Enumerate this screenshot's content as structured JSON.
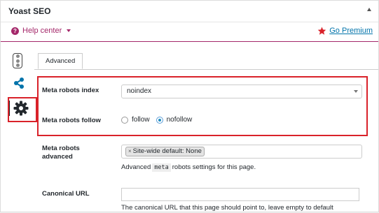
{
  "metabox": {
    "title": "Yoast SEO",
    "help_center_label": "Help center",
    "go_premium_label": "Go Premium",
    "colors": {
      "brand": "#a4286a",
      "link": "#0073aa",
      "highlight": "#d9222a"
    }
  },
  "side_tabs": [
    {
      "name": "readability",
      "icon": "traffic-light-icon"
    },
    {
      "name": "social",
      "icon": "share-icon"
    },
    {
      "name": "advanced",
      "icon": "gear-icon",
      "active": true
    }
  ],
  "tabs": {
    "advanced": "Advanced"
  },
  "fields": {
    "robots_index": {
      "label": "Meta robots index",
      "value": "noindex"
    },
    "robots_follow": {
      "label": "Meta robots follow",
      "options": [
        "follow",
        "nofollow"
      ],
      "selected": "nofollow"
    },
    "robots_advanced": {
      "label_line1": "Meta robots",
      "label_line2": "advanced",
      "tag": "Site-wide default: None",
      "help_prefix": "Advanced",
      "help_code": "meta",
      "help_suffix": "robots settings for this page."
    },
    "canonical": {
      "label": "Canonical URL",
      "value": "",
      "help": "The canonical URL that this page should point to, leave empty to default"
    }
  }
}
